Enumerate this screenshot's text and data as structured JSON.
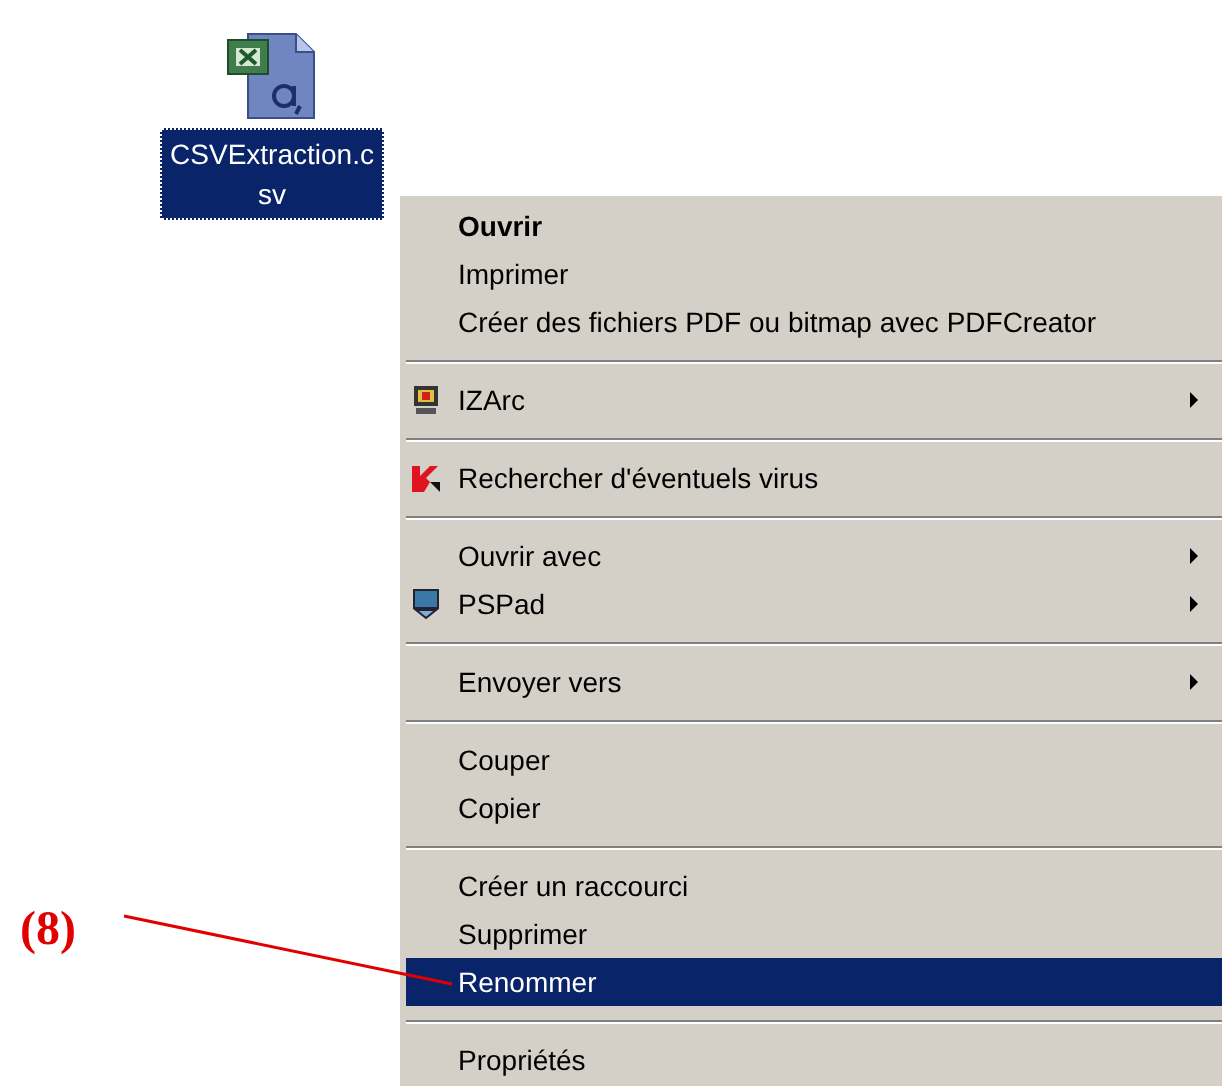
{
  "desktop_icon": {
    "label": "CSVExtraction.csv",
    "selected": true
  },
  "context_menu": {
    "items": [
      {
        "kind": "plain",
        "label": "Ouvrir",
        "bold": true,
        "selected": false,
        "submenu": false
      },
      {
        "kind": "plain",
        "label": "Imprimer",
        "bold": false,
        "selected": false,
        "submenu": false
      },
      {
        "kind": "plain",
        "label": "Créer des fichiers PDF ou bitmap avec PDFCreator",
        "bold": false,
        "selected": false,
        "submenu": false
      },
      {
        "kind": "separator"
      },
      {
        "kind": "archive",
        "label": "IZArc",
        "bold": false,
        "selected": false,
        "submenu": true
      },
      {
        "kind": "separator"
      },
      {
        "kind": "scan",
        "label": "Rechercher d'éventuels virus",
        "bold": false,
        "selected": false,
        "submenu": false
      },
      {
        "kind": "separator"
      },
      {
        "kind": "plain",
        "label": "Ouvrir avec",
        "bold": false,
        "selected": false,
        "submenu": true
      },
      {
        "kind": "editor",
        "label": "PSPad",
        "bold": false,
        "selected": false,
        "submenu": true
      },
      {
        "kind": "separator"
      },
      {
        "kind": "plain",
        "label": "Envoyer vers",
        "bold": false,
        "selected": false,
        "submenu": true
      },
      {
        "kind": "separator"
      },
      {
        "kind": "plain",
        "label": "Couper",
        "bold": false,
        "selected": false,
        "submenu": false
      },
      {
        "kind": "plain",
        "label": "Copier",
        "bold": false,
        "selected": false,
        "submenu": false
      },
      {
        "kind": "separator"
      },
      {
        "kind": "plain",
        "label": "Créer un raccourci",
        "bold": false,
        "selected": false,
        "submenu": false
      },
      {
        "kind": "plain",
        "label": "Supprimer",
        "bold": false,
        "selected": false,
        "submenu": false
      },
      {
        "kind": "plain",
        "label": "Renommer",
        "bold": false,
        "selected": true,
        "submenu": false
      },
      {
        "kind": "separator"
      },
      {
        "kind": "plain",
        "label": "Propriétés",
        "bold": false,
        "selected": false,
        "submenu": false
      }
    ]
  },
  "annotation": {
    "label": "(8)"
  }
}
